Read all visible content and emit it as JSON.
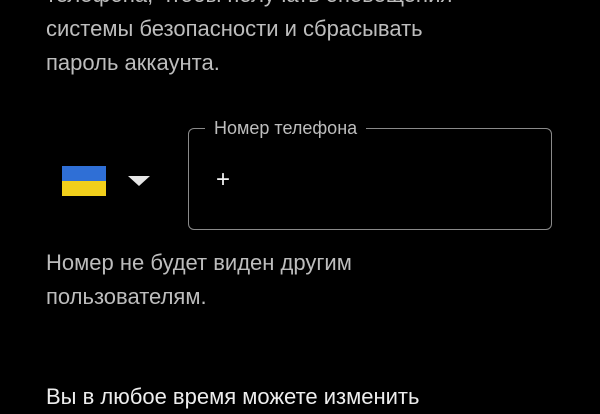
{
  "intro": {
    "lines": [
      "телефона, чтобы получать оповещения",
      "системы безопасности и сбрасывать",
      "пароль аккаунта."
    ]
  },
  "country_picker": {
    "flag": "ukraine-flag",
    "flag_colors": [
      "#2f6fd6",
      "#f1cf1b"
    ],
    "dropdown_icon": "caret-down-icon"
  },
  "phone_field": {
    "label": "Номер телефона",
    "value": "+"
  },
  "hint": {
    "lines": [
      "Номер не будет виден другим",
      "пользователям."
    ]
  },
  "footer_text": "Вы в любое время можете изменить",
  "colors": {
    "background": "#000000",
    "text_secondary": "#bdbdbd",
    "outline": "#8a8a8a"
  }
}
